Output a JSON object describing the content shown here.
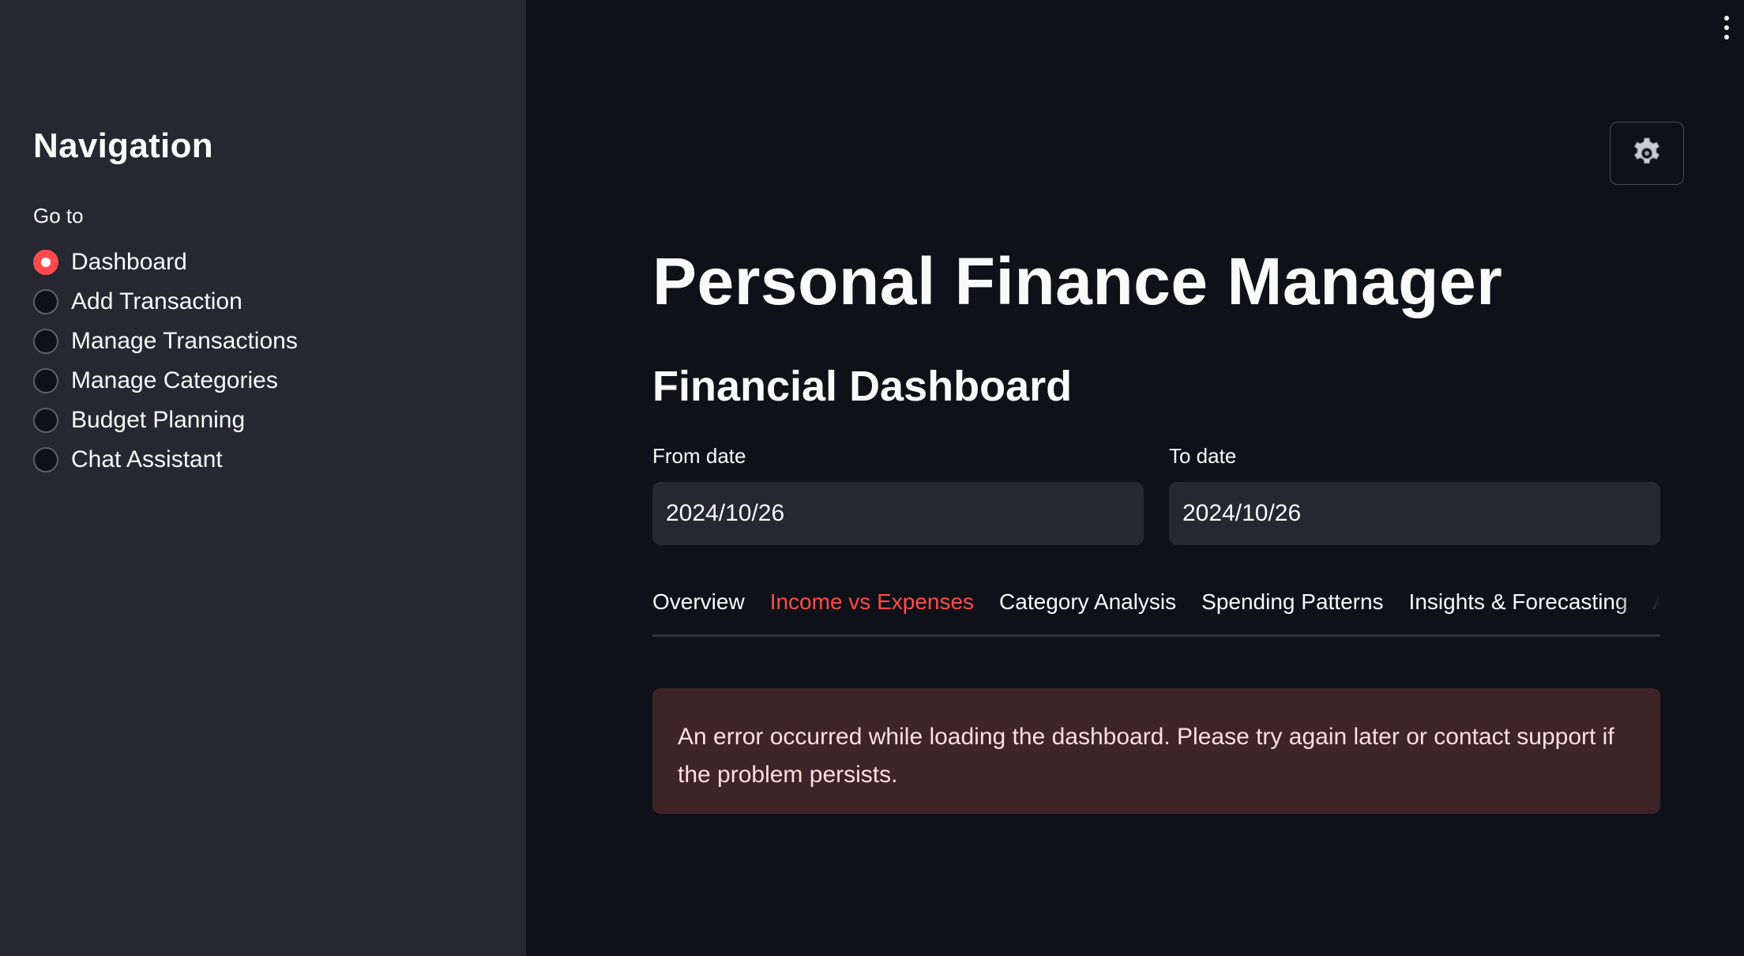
{
  "sidebar": {
    "title": "Navigation",
    "radio_label": "Go to",
    "items": [
      {
        "label": "Dashboard",
        "selected": true
      },
      {
        "label": "Add Transaction",
        "selected": false
      },
      {
        "label": "Manage Transactions",
        "selected": false
      },
      {
        "label": "Manage Categories",
        "selected": false
      },
      {
        "label": "Budget Planning",
        "selected": false
      },
      {
        "label": "Chat Assistant",
        "selected": false
      }
    ]
  },
  "header": {
    "menu_icon": "vertical-dots-icon",
    "settings_icon": "gear-icon"
  },
  "main": {
    "title": "Personal Finance Manager",
    "subtitle": "Financial Dashboard",
    "from_date": {
      "label": "From date",
      "value": "2024/10/26"
    },
    "to_date": {
      "label": "To date",
      "value": "2024/10/26"
    },
    "tabs": [
      {
        "label": "Overview",
        "active": false
      },
      {
        "label": "Income vs Expenses",
        "active": true
      },
      {
        "label": "Category Analysis",
        "active": false
      },
      {
        "label": "Spending Patterns",
        "active": false
      },
      {
        "label": "Insights & Forecasting",
        "active": false
      },
      {
        "label": "Advanced",
        "active": false
      }
    ],
    "error_message": "An error occurred while loading the dashboard. Please try again later or contact support if the problem persists."
  },
  "colors": {
    "accent": "#ff4b4b",
    "background": "#0e1117",
    "sidebar": "#262730",
    "error_bg": "#3e2428"
  }
}
